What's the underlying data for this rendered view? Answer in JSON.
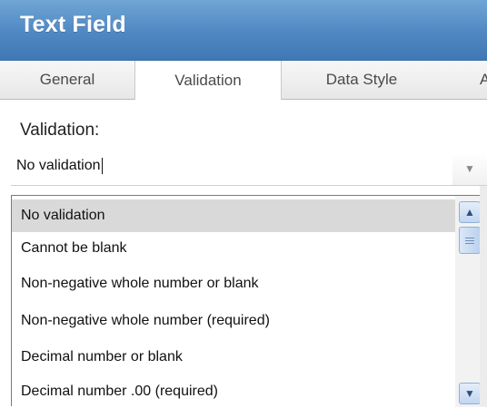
{
  "window": {
    "title": "Text Field"
  },
  "tabs": [
    {
      "label": "General"
    },
    {
      "label": "Validation"
    },
    {
      "label": "Data Style"
    },
    {
      "label": "A"
    }
  ],
  "validation": {
    "label": "Validation:",
    "current_value": "No validation",
    "options": [
      "No validation",
      "Cannot be blank",
      "Non-negative whole number or blank",
      "Non-negative whole number (required)",
      "Decimal number or blank",
      "Decimal number .00 (required)"
    ],
    "selected_index": 0
  },
  "icons": {
    "dropdown_arrow": "chevron-down-icon",
    "scroll_up": "arrow-up-icon",
    "scroll_down": "arrow-down-icon"
  },
  "colors": {
    "title_bar": "#4f88c2",
    "selected_option_bg": "#d9d9d9",
    "scrollbar_accent": "#8fb0d8"
  }
}
